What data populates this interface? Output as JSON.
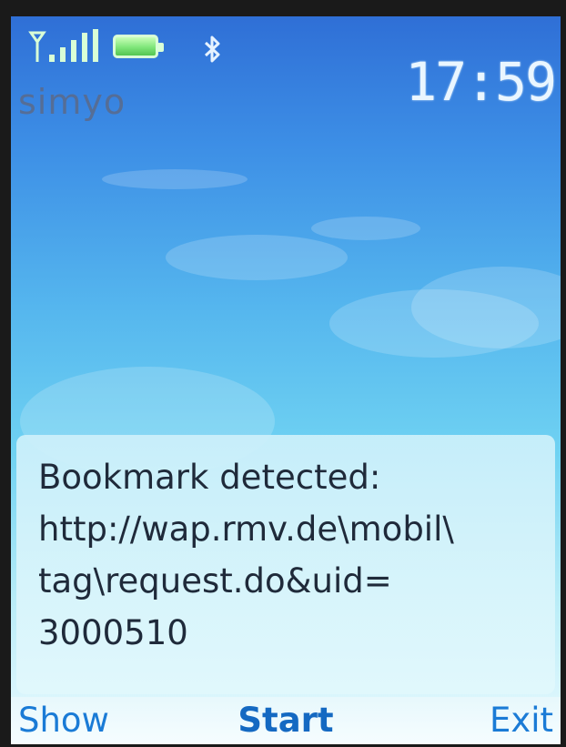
{
  "status_bar": {
    "operator": "simyo",
    "time": "17:59",
    "icons": [
      "signal-strength-icon",
      "battery-icon",
      "bluetooth-icon"
    ]
  },
  "message": {
    "text": "Bookmark detected:\nhttp://wap.rmv.de\\mobil\\\ntag\\request.do&uid=\n3000510"
  },
  "softkeys": {
    "left": "Show",
    "center": "Start",
    "right": "Exit"
  },
  "colors": {
    "softkey": "#1a7bd6",
    "background_top": "#2f6fd6",
    "background_bottom": "#eafaff"
  }
}
